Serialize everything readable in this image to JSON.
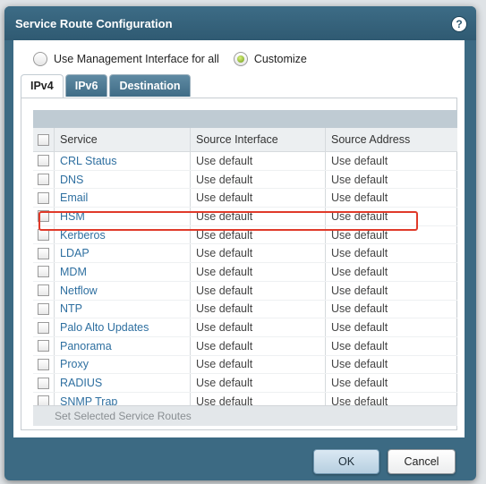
{
  "dialog": {
    "title": "Service Route Configuration",
    "help_icon": "?"
  },
  "mode": {
    "option_mgmt": "Use Management Interface for all",
    "option_custom": "Customize",
    "selected": "Customize"
  },
  "tabs": [
    {
      "label": "IPv4",
      "active": true
    },
    {
      "label": "IPv6",
      "active": false
    },
    {
      "label": "Destination",
      "active": false
    }
  ],
  "table": {
    "columns": [
      "Service",
      "Source Interface",
      "Source Address"
    ],
    "rows": [
      {
        "service": "CRL Status",
        "source_interface": "Use default",
        "source_address": "Use default"
      },
      {
        "service": "DNS",
        "source_interface": "Use default",
        "source_address": "Use default"
      },
      {
        "service": "Email",
        "source_interface": "Use default",
        "source_address": "Use default"
      },
      {
        "service": "HSM",
        "source_interface": "Use default",
        "source_address": "Use default"
      },
      {
        "service": "Kerberos",
        "source_interface": "Use default",
        "source_address": "Use default"
      },
      {
        "service": "LDAP",
        "source_interface": "Use default",
        "source_address": "Use default"
      },
      {
        "service": "MDM",
        "source_interface": "Use default",
        "source_address": "Use default"
      },
      {
        "service": "Netflow",
        "source_interface": "Use default",
        "source_address": "Use default"
      },
      {
        "service": "NTP",
        "source_interface": "Use default",
        "source_address": "Use default"
      },
      {
        "service": "Palo Alto Updates",
        "source_interface": "Use default",
        "source_address": "Use default"
      },
      {
        "service": "Panorama",
        "source_interface": "Use default",
        "source_address": "Use default"
      },
      {
        "service": "Proxy",
        "source_interface": "Use default",
        "source_address": "Use default"
      },
      {
        "service": "RADIUS",
        "source_interface": "Use default",
        "source_address": "Use default"
      },
      {
        "service": "SNMP Trap",
        "source_interface": "Use default",
        "source_address": "Use default"
      }
    ],
    "footer_action": "Set Selected Service Routes"
  },
  "buttons": {
    "ok": "OK",
    "cancel": "Cancel"
  },
  "colors": {
    "titlebar": "#3c6a83",
    "link": "#2e6fa0",
    "highlight": "#e03a2a"
  }
}
